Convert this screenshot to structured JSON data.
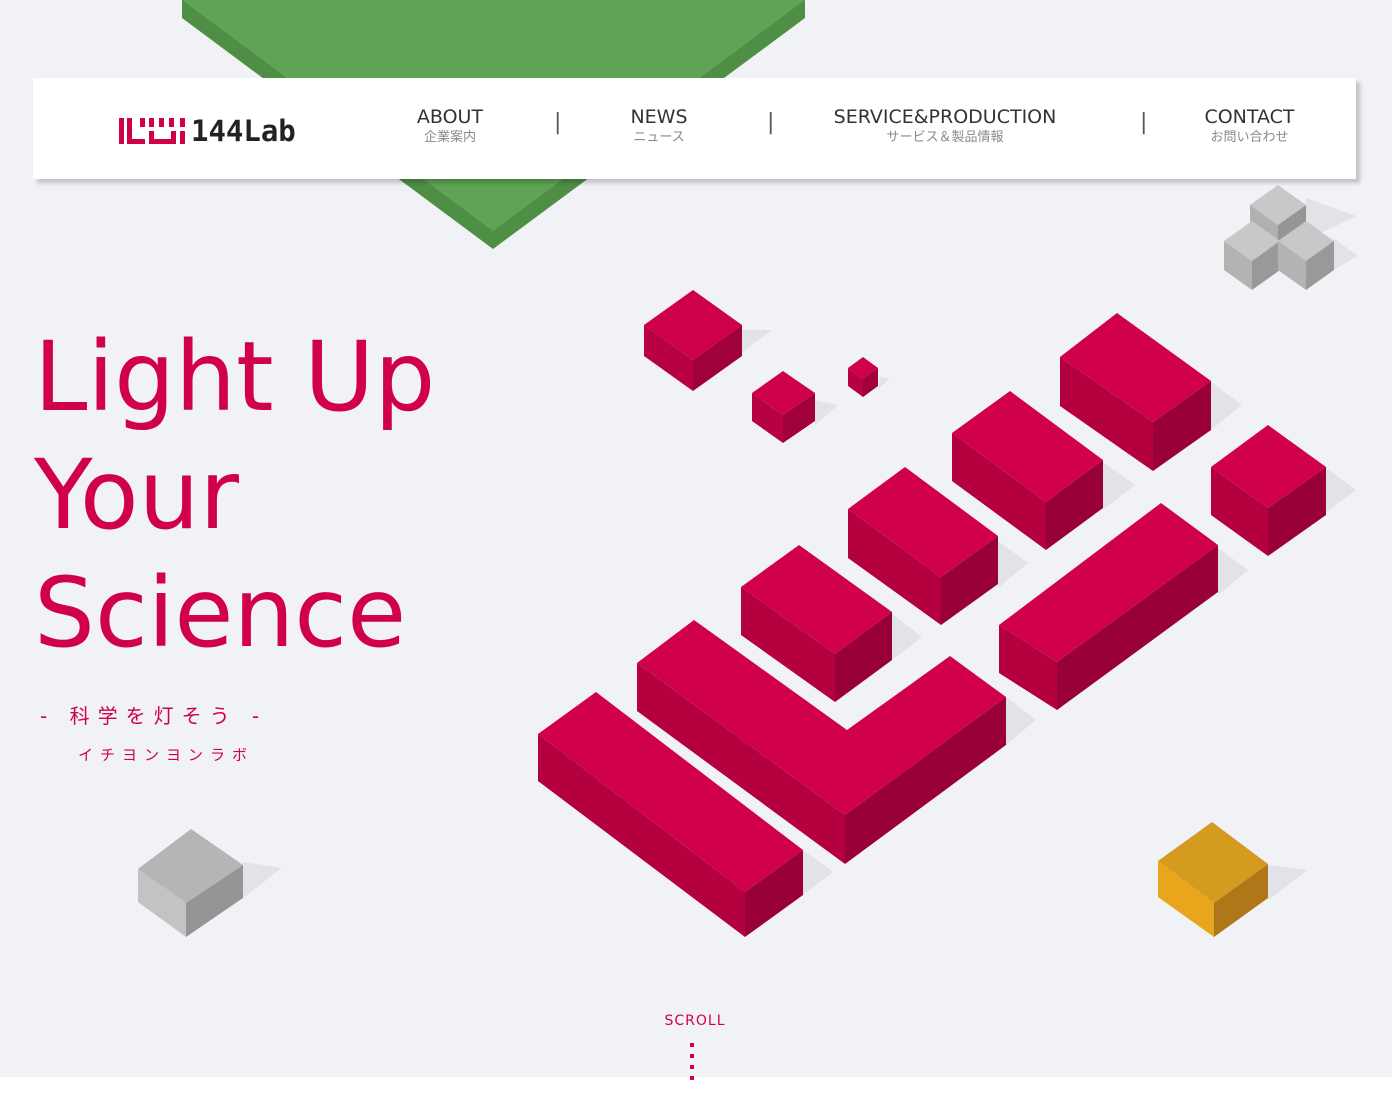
{
  "header": {
    "logo_text": "144Lab",
    "nav": [
      {
        "en": "ABOUT",
        "jp": "企業案内"
      },
      {
        "en": "NEWS",
        "jp": "ニュース"
      },
      {
        "en": "SERVICE&PRODUCTION",
        "jp": "サービス＆製品情報"
      },
      {
        "en": "CONTACT",
        "jp": "お問い合わせ"
      }
    ],
    "separator": "|"
  },
  "hero": {
    "headline": [
      "Light Up",
      "Your",
      "Science"
    ],
    "tagline": "- 科学を灯そう -",
    "reading": "イチヨンヨンラボ"
  },
  "scroll_label": "SCROLL",
  "colors": {
    "accent": "#d1004b",
    "background": "#f1f2f6",
    "green": "#5fa455",
    "gold": "#e3a221",
    "gray": "#b9b9b9"
  },
  "icons": {
    "logo_mark": "144lab-logo-mark-icon",
    "scroll_indicator": "dotted-line-icon"
  }
}
